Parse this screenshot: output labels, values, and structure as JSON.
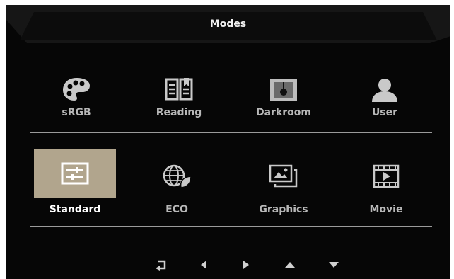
{
  "title": "Modes",
  "row1": [
    {
      "label": "sRGB",
      "icon": "palette-icon"
    },
    {
      "label": "Reading",
      "icon": "book-icon"
    },
    {
      "label": "Darkroom",
      "icon": "darkroom-icon"
    },
    {
      "label": "User",
      "icon": "user-icon"
    }
  ],
  "row2": [
    {
      "label": "Standard",
      "icon": "sliders-icon",
      "selected": true
    },
    {
      "label": "ECO",
      "icon": "eco-globe-icon"
    },
    {
      "label": "Graphics",
      "icon": "graphics-icon"
    },
    {
      "label": "Movie",
      "icon": "film-icon"
    }
  ],
  "nav": [
    "back-icon",
    "left-arrow-icon",
    "right-arrow-icon",
    "up-arrow-icon",
    "down-arrow-icon"
  ],
  "colors": {
    "background": "#060606",
    "selected": "#b1a58d",
    "text": "#b8b8b8",
    "divider": "#9a9a9a"
  }
}
